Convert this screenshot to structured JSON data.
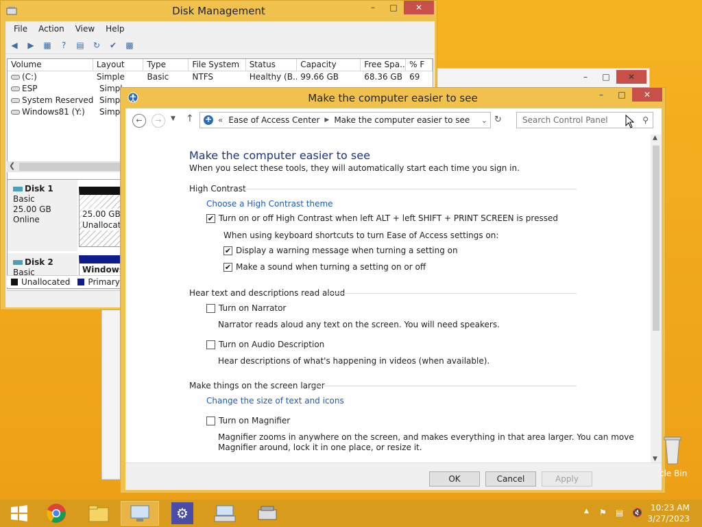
{
  "disk_mgmt": {
    "title": "Disk Management",
    "menu": [
      "File",
      "Action",
      "View",
      "Help"
    ],
    "columns": [
      "Volume",
      "Layout",
      "Type",
      "File System",
      "Status",
      "Capacity",
      "Free Spa...",
      "% F"
    ],
    "rows": [
      [
        "(C:)",
        "Simple",
        "Basic",
        "NTFS",
        "Healthy (B...",
        "99.66 GB",
        "68.36 GB",
        "69"
      ],
      [
        "ESP",
        "Simpl",
        "",
        "",
        "",
        "",
        "",
        ""
      ],
      [
        "System Reserved",
        "Simpl",
        "",
        "",
        "",
        "",
        "",
        ""
      ],
      [
        "Windows81 (Y:)",
        "Simpl",
        "",
        "",
        "",
        "",
        "",
        ""
      ]
    ],
    "disks": [
      {
        "name": "Disk 1",
        "type": "Basic",
        "size": "25.00 GB",
        "state": "Online",
        "part_size": "25.00 GB",
        "part_state": "Unallocat"
      },
      {
        "name": "Disk 2",
        "type": "Basic",
        "part_label": "Windows"
      }
    ],
    "legend": {
      "unallocated": "Unallocated",
      "primary": "Primary par"
    }
  },
  "eoa": {
    "title": "Make the computer easier to see",
    "breadcrumb": [
      "Ease of Access Center",
      "Make the computer easier to see"
    ],
    "breadcrumb_prefix": "«",
    "search_placeholder": "Search Control Panel",
    "heading": "Make the computer easier to see",
    "subheading": "When you select these tools, they will automatically start each time you sign in.",
    "sections": {
      "contrast": "High Contrast",
      "narrator": "Hear text and descriptions read aloud",
      "larger": "Make things on the screen larger"
    },
    "links": {
      "contrast_theme": "Choose a High Contrast theme",
      "text_size": "Change the size of text and icons"
    },
    "options": {
      "hc_toggle": "Turn on or off High Contrast when left ALT + left SHIFT + PRINT SCREEN is pressed",
      "hc_note": "When using keyboard shortcuts to turn Ease of Access settings on:",
      "warn": "Display a warning message when turning a setting on",
      "sound": "Make a sound when turning a setting on or off",
      "narrator": "Turn on Narrator",
      "narrator_desc": "Narrator reads aloud any text on the screen. You will need speakers.",
      "audio_desc": "Turn on Audio Description",
      "audio_desc_desc": "Hear descriptions of what's happening in videos (when available).",
      "magnifier": "Turn on Magnifier",
      "magnifier_desc1": "Magnifier zooms in anywhere on the screen, and makes everything in that area larger. You can move",
      "magnifier_desc2": "Magnifier around, lock it in one place, or resize it."
    },
    "buttons": {
      "ok": "OK",
      "cancel": "Cancel",
      "apply": "Apply"
    }
  },
  "desktop": {
    "recycle_label": "cle Bin"
  },
  "taskbar": {
    "time": "10:23 AM",
    "date": "3/27/2023"
  },
  "colors": {
    "accent": "#f0c24d",
    "link": "#1c5bb5",
    "heading": "#1e3287",
    "close": "#c7504a",
    "taskbar": "#d89b1c"
  }
}
